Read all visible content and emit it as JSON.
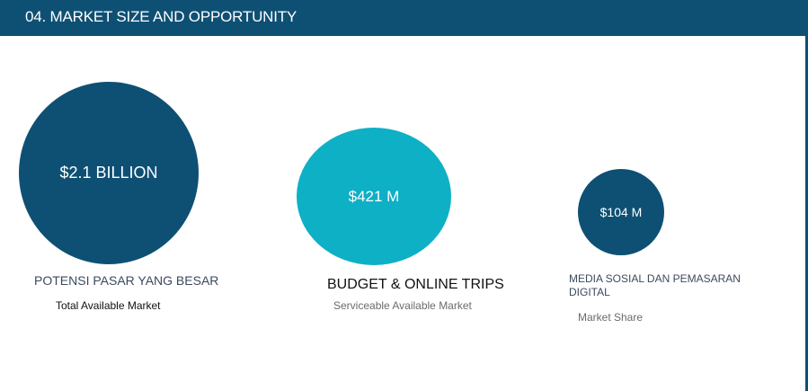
{
  "header": {
    "title": "04. MARKET SIZE AND OPPORTUNITY"
  },
  "colors": {
    "header_bg": "#0e5074",
    "circle_dark": "#0e5074",
    "circle_teal": "#0eb0c5"
  },
  "markets": [
    {
      "value": "$2.1 BILLION",
      "title": "POTENSI PASAR YANG BESAR",
      "subtitle": "Total Available Market",
      "color": "#0e5074"
    },
    {
      "value": "$421 M",
      "title": "BUDGET & ONLINE TRIPS",
      "subtitle": "Serviceable Available Market",
      "color": "#0eb0c5"
    },
    {
      "value": "$104 M",
      "title": "MEDIA SOSIAL DAN PEMASARAN DIGITAL",
      "subtitle": "Market Share",
      "color": "#0e5074"
    }
  ]
}
